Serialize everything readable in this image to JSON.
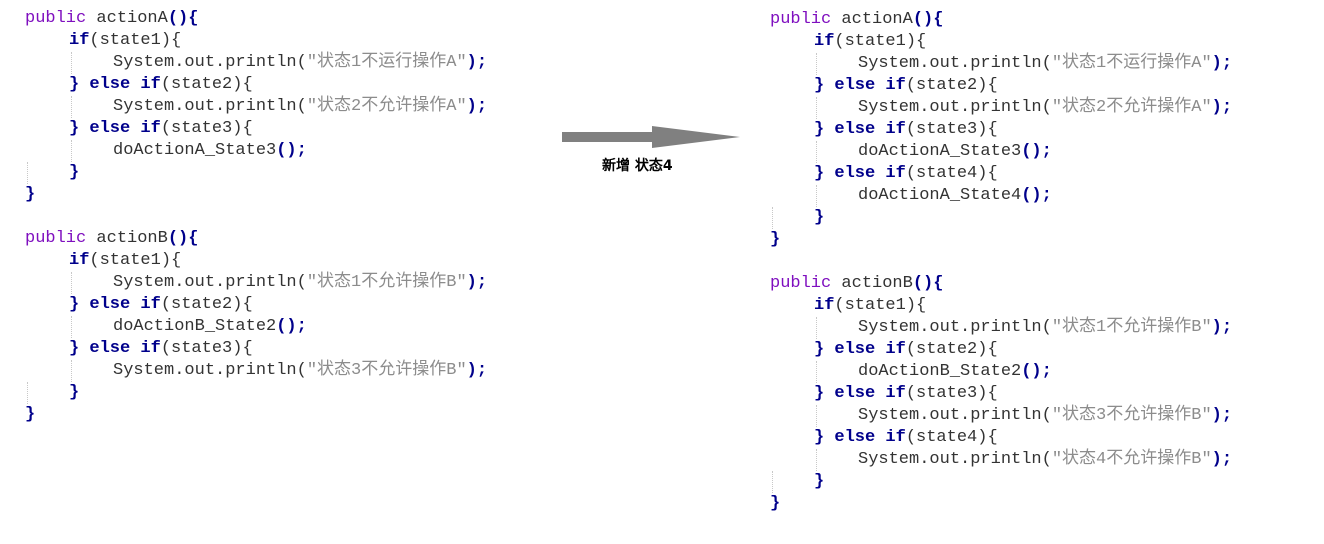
{
  "left_code": {
    "actionA": {
      "l1_mod": "public ",
      "l1_name": "actionA",
      "l1_paren": "(){",
      "l2_kw": "if",
      "l2_cond": "(state1){",
      "l3_call": "System.out.println(",
      "l3_str": "\"状态1不运行操作A\"",
      "l3_end": ");",
      "l4_close": "} ",
      "l4_else": "else ",
      "l4_if": "if",
      "l4_cond": "(state2){",
      "l5_call": "System.out.println(",
      "l5_str": "\"状态2不允许操作A\"",
      "l5_end": ");",
      "l6_close": "} ",
      "l6_else": "else ",
      "l6_if": "if",
      "l6_cond": "(state3){",
      "l7_call": "doActionA_State3",
      "l7_end": "();",
      "l8_close": "}",
      "l9_close": "}"
    },
    "actionB": {
      "l1_mod": "public ",
      "l1_name": "actionB",
      "l1_paren": "(){",
      "l2_kw": "if",
      "l2_cond": "(state1){",
      "l3_call": "System.out.println(",
      "l3_str": "\"状态1不允许操作B\"",
      "l3_end": ");",
      "l4_close": "} ",
      "l4_else": "else ",
      "l4_if": "if",
      "l4_cond": "(state2){",
      "l5_call": "doActionB_State2",
      "l5_end": "();",
      "l6_close": "} ",
      "l6_else": "else ",
      "l6_if": "if",
      "l6_cond": "(state3){",
      "l7_call": "System.out.println(",
      "l7_str": "\"状态3不允许操作B\"",
      "l7_end": ");",
      "l8_close": "}",
      "l9_close": "}"
    }
  },
  "arrow": {
    "label": "新增 状态4",
    "color": "#808080"
  },
  "right_code": {
    "actionA": {
      "l1_mod": "public ",
      "l1_name": "actionA",
      "l1_paren": "(){",
      "l2_kw": "if",
      "l2_cond": "(state1){",
      "l3_call": "System.out.println(",
      "l3_str": "\"状态1不运行操作A\"",
      "l3_end": ");",
      "l4_close": "} ",
      "l4_else": "else ",
      "l4_if": "if",
      "l4_cond": "(state2){",
      "l5_call": "System.out.println(",
      "l5_str": "\"状态2不允许操作A\"",
      "l5_end": ");",
      "l6_close": "} ",
      "l6_else": "else ",
      "l6_if": "if",
      "l6_cond": "(state3){",
      "l7_call": "doActionA_State3",
      "l7_end": "();",
      "l8_close": "} ",
      "l8_else": "else ",
      "l8_if": "if",
      "l8_cond": "(state4){",
      "l9_call": "doActionA_State4",
      "l9_end": "();",
      "l10_close": "}",
      "l11_close": "}"
    },
    "actionB": {
      "l1_mod": "public ",
      "l1_name": "actionB",
      "l1_paren": "(){",
      "l2_kw": "if",
      "l2_cond": "(state1){",
      "l3_call": "System.out.println(",
      "l3_str": "\"状态1不允许操作B\"",
      "l3_end": ");",
      "l4_close": "} ",
      "l4_else": "else ",
      "l4_if": "if",
      "l4_cond": "(state2){",
      "l5_call": "doActionB_State2",
      "l5_end": "();",
      "l6_close": "} ",
      "l6_else": "else ",
      "l6_if": "if",
      "l6_cond": "(state3){",
      "l7_call": "System.out.println(",
      "l7_str": "\"状态3不允许操作B\"",
      "l7_end": ");",
      "l8_close": "} ",
      "l8_else": "else ",
      "l8_if": "if",
      "l8_cond": "(state4){",
      "l9_call": "System.out.println(",
      "l9_str": "\"状态4不允许操作B\"",
      "l9_end": ");",
      "l10_close": "}",
      "l11_close": "}"
    }
  }
}
